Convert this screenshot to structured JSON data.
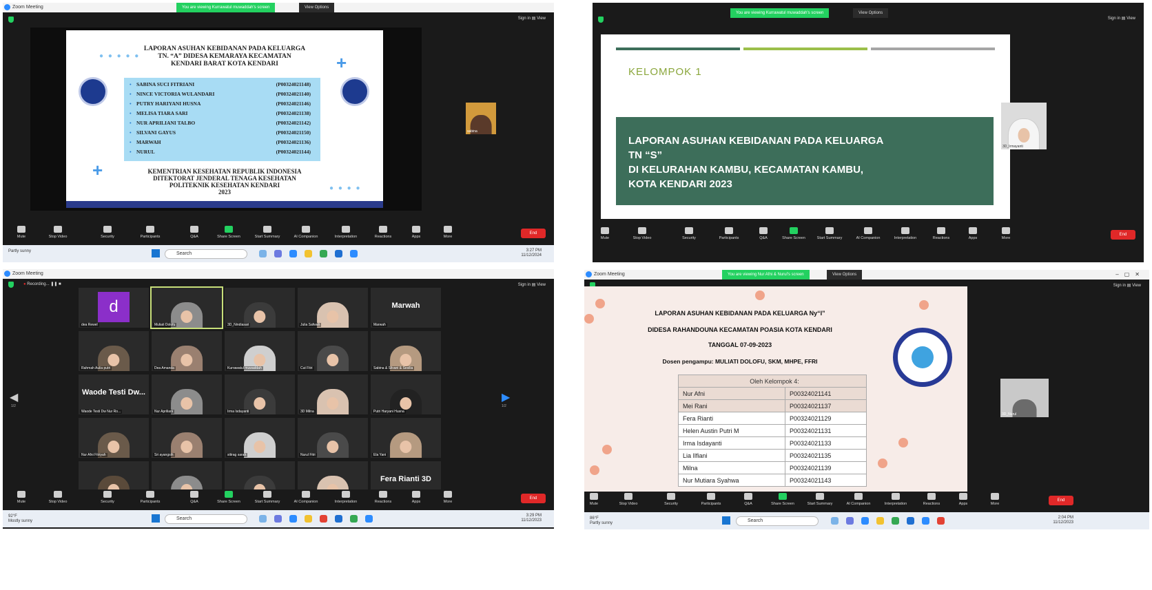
{
  "q1": {
    "title": "Zoom Meeting",
    "banner": "You are viewing Kurrawatul muwaddah's screen",
    "view_options": "View Options",
    "signin": "Sign in  ▤ View",
    "slide": {
      "title": [
        "LAPORAN ASUHAN KEBIDANAN PADA KELUARGA",
        "TN. “A” DIDESA KEMARAYA KECAMATAN",
        "KENDARI BARAT KOTA KENDARI"
      ],
      "members": [
        {
          "name": "SABINA SUCI FITRIANI",
          "id": "(P00324021148)"
        },
        {
          "name": "NINCE VICTORIA WULANDARI",
          "id": "(P00324021140)"
        },
        {
          "name": "PUTRY HARIYANI HUSNA",
          "id": "(P00324021146)"
        },
        {
          "name": "MELISA TIARA SARI",
          "id": "(P00324021138)"
        },
        {
          "name": "NUR APRILIANI TALBO",
          "id": "(P00324021142)"
        },
        {
          "name": "SILVANI GAYUS",
          "id": "(P00324021150)"
        },
        {
          "name": "MARWAH",
          "id": "(P00324021136)"
        },
        {
          "name": "NURUL",
          "id": "(P00324021144)"
        }
      ],
      "footer": [
        "KEMENTRIAN KESEHATAN REPUBLIK INDONESIA",
        "DITEKTORAT JENDERAL TENAGA KESEHATAN",
        "POLITEKNIK KESEHATAN KENDARI",
        "2023"
      ]
    },
    "self_cam_label": "sabina",
    "time": "3:27 PM",
    "date": "11/12/2024",
    "weather": "Partly sunny"
  },
  "q2": {
    "banner": "You are viewing Kurrawatul muwaddah's screen",
    "view_options": "View Options",
    "signin": "Sign in  ▤ View",
    "kelompok": "KELOMPOK  1",
    "report": [
      "LAPORAN ASUHAN KEBIDANAN PADA KELUARGA",
      "TN “S”",
      "DI KELURAHAN KAMBU, KECAMATAN KAMBU,",
      "KOTA KENDARI 2023"
    ],
    "self_cam_label": "3D_Irmayanti"
  },
  "q3": {
    "title": "Zoom Meeting",
    "recording": "Recording...",
    "signin": "Sign in  ▤ View",
    "participants": [
      "dea Rewel",
      "Muliati Dolofu",
      "3D_Nindiasari",
      "Julia Safwah",
      "Marwah",
      "Rahmah Aulia putri",
      "Dea Amanda",
      "Kurrawatul muwaddah",
      "Cut Fitri",
      "Sabina & Silvani & Sesilia",
      "Waode Testi Dw Nur Ro...",
      "Nur Apriliani",
      "Irma Isdayanti",
      "3D Milna",
      "Putri Haryani Husna",
      "Nur Afni Fitriyah",
      "Sri ayangsih",
      "sitirag sarah",
      "Nurul Fitri",
      "Ela Yani",
      "Helen putri",
      "Fitti Aswandi",
      "Yuffiah",
      "Sadi Nur Rahmah",
      "Fera Rianti 3D"
    ],
    "big_names": [
      "Marwah",
      "Waode Testi Dw...",
      "Fera Rianti 3D"
    ],
    "letter": "d",
    "page_left": "1/2",
    "page_right": "1/2",
    "time": "3:29 PM",
    "date": "11/12/2023",
    "temp": "92°F",
    "weather": "Mostly sunny"
  },
  "q4": {
    "title": "Zoom Meeting",
    "banner": "You are viewing Nur Afni & Nurul's screen",
    "view_options": "View Options",
    "signin": "Sign in  ▤ View",
    "slide": {
      "title": "LAPORAN ASUHAN KEBIDANAN PADA KELUARGA Ny“I”",
      "line2": "DIDESA RAHANDOUNA KECAMATAN POASIA KOTA KENDARI",
      "date": "TANGGAL 07-09-2023",
      "dosen": "Dosen pengampu: MULIATI DOLOFU, SKM, MHPE, FFRI",
      "table_header": "Oleh Kelompok 4:",
      "rows": [
        {
          "name": "Nur Afni",
          "id": "P00324021141"
        },
        {
          "name": "Mei Rani",
          "id": "P00324021137"
        },
        {
          "name": "Fera Rianti",
          "id": "P00324021129"
        },
        {
          "name": "Helen Austin Putri M",
          "id": "P00324021131"
        },
        {
          "name": "Irma Isdayanti",
          "id": "P00324021133"
        },
        {
          "name": "Lia Ilfiani",
          "id": "P00324021135"
        },
        {
          "name": "Milna",
          "id": "P00324021139"
        },
        {
          "name": "Nur Mutiara Syahwa",
          "id": "P00324021143"
        }
      ]
    },
    "self_cam_label": "3D_Nurul",
    "time": "2:04 PM",
    "date": "11/12/2023",
    "temp": "86°F",
    "weather": "Partly sunny"
  },
  "toolbar": {
    "mute": "Mute",
    "stop_video": "Stop Video",
    "security": "Security",
    "participants": "Participants",
    "qa": "Q&A",
    "share": "Share Screen",
    "summary": "Start Summary",
    "ai": "AI Companion",
    "interp": "Interpretation",
    "reactions": "Reactions",
    "apps": "Apps",
    "more": "More",
    "end": "End",
    "count_q1": "27",
    "count_q2": "27",
    "count_q3": "27",
    "count_q4": "32"
  },
  "taskbar": {
    "search": "Search"
  },
  "colors": {
    "zoom_green": "#23d160",
    "end_red": "#e02828",
    "slide_green": "#3d6e5a"
  }
}
